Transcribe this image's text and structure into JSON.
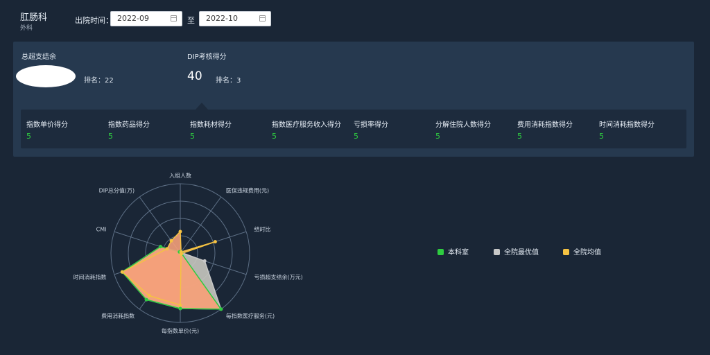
{
  "header": {
    "dept_name": "肛肠科",
    "dept_sub": "外科",
    "date_label": "出院时间：",
    "date_from": "2022-09",
    "date_separator": "至",
    "date_to": "2022-10"
  },
  "summary": {
    "total_label": "总超支结余",
    "total_rank_label": "排名：22",
    "dip_label": "DIP考核得分",
    "dip_score": "40",
    "dip_rank_label": "排名：3"
  },
  "scores": [
    {
      "label": "指数单价得分",
      "value": "5"
    },
    {
      "label": "指数药品得分",
      "value": "5"
    },
    {
      "label": "指数耗材得分",
      "value": "5"
    },
    {
      "label": "指数医疗服务收入得分",
      "value": "5"
    },
    {
      "label": "亏损率得分",
      "value": "5"
    },
    {
      "label": "分解住院人数得分",
      "value": "5"
    },
    {
      "label": "费用消耗指数得分",
      "value": "5"
    },
    {
      "label": "时间消耗指数得分",
      "value": "5"
    }
  ],
  "chart_data": {
    "type": "radar",
    "axes": [
      "入组人数",
      "医保违规费用(元)",
      "结时比",
      "亏损超支结余(万元)",
      "每指数医疗服务(元)",
      "每指数单价(元)",
      "费用消耗指数",
      "时间消耗指数",
      "CMI",
      "DIP总分值(万)"
    ],
    "range": [
      0,
      1
    ],
    "series": [
      {
        "name": "本科室",
        "color": "#2ecc40",
        "values": [
          0.02,
          0.02,
          0.02,
          0.02,
          1.0,
          0.8,
          0.83,
          0.88,
          0.3,
          0.02
        ]
      },
      {
        "name": "全院最优值",
        "color": "#c8c8c8",
        "values": [
          0.02,
          0.02,
          0.02,
          0.37,
          1.0,
          0.8,
          0.83,
          0.88,
          0.3,
          0.02
        ]
      },
      {
        "name": "全院均值",
        "color": "#f5c242",
        "values": [
          0.31,
          0.02,
          0.53,
          0.02,
          0.02,
          0.75,
          0.76,
          0.88,
          0.2,
          0.22
        ]
      }
    ]
  }
}
